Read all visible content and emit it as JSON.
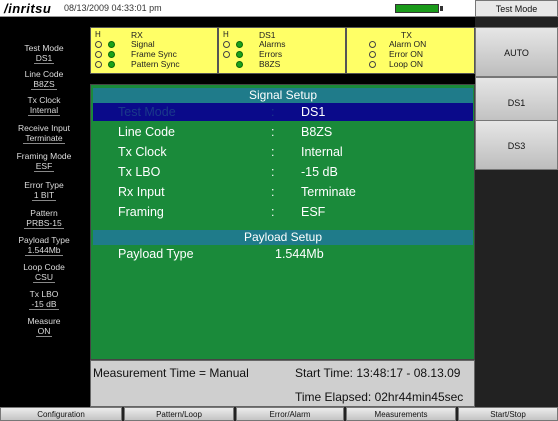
{
  "topbar": {
    "logo": "/inritsu",
    "datetime": "08/13/2009 04:33:01 pm"
  },
  "status": {
    "rx": {
      "h": "H",
      "title": "RX",
      "rows": [
        "Signal",
        "Frame Sync",
        "Pattern Sync"
      ]
    },
    "ds1": {
      "h": "H",
      "title": "DS1",
      "rows": [
        "Alarms",
        "Errors",
        "B8ZS"
      ]
    },
    "tx": {
      "title": "TX",
      "rows": [
        "Alarm ON",
        "Error  ON",
        "Loop  ON"
      ]
    }
  },
  "sidebar": {
    "items": [
      {
        "label": "Test Mode",
        "value": "DS1"
      },
      {
        "label": "Line Code",
        "value": "B8ZS"
      },
      {
        "label": "Tx Clock",
        "value": "Internal"
      },
      {
        "label": "Receive Input",
        "value": "Terminate"
      },
      {
        "label": "Framing Mode",
        "value": "ESF"
      },
      {
        "label": "Error Type",
        "value": "1 BIT"
      },
      {
        "label": "Pattern",
        "value": "PRBS-15"
      },
      {
        "label": "Payload Type",
        "value": "1.544Mb"
      },
      {
        "label": "Loop Code",
        "value": "CSU"
      },
      {
        "label": "Tx LBO",
        "value": "-15 dB"
      },
      {
        "label": "Measure",
        "value": "ON"
      }
    ]
  },
  "signal_setup": {
    "header": "Signal Setup",
    "rows": [
      {
        "label": "Test Mode",
        "colon": ":",
        "value": "DS1"
      },
      {
        "label": "Line Code",
        "colon": ":",
        "value": "B8ZS"
      },
      {
        "label": "Tx Clock",
        "colon": ":",
        "value": "Internal"
      },
      {
        "label": "Tx LBO",
        "colon": ":",
        "value": "-15 dB"
      },
      {
        "label": "Rx Input",
        "colon": ":",
        "value": "Terminate"
      },
      {
        "label": "Framing",
        "colon": ":",
        "value": "ESF"
      }
    ]
  },
  "payload_setup": {
    "header": "Payload Setup",
    "rows": [
      {
        "label": "Payload Type",
        "value": "1.544Mb"
      }
    ]
  },
  "measurement": {
    "mode": "Measurement Time = Manual",
    "start": "Start Time: 13:48:17 -  08.13.09",
    "elapsed": "Time Elapsed: 02hr44min45sec"
  },
  "right_keys": {
    "title": "Test Mode",
    "keys": [
      "AUTO",
      "DS1",
      "DS3"
    ]
  },
  "bottom_keys": [
    "Configuration",
    "Pattern/Loop",
    "Error/Alarm",
    "Measurements",
    "Start/Stop"
  ]
}
